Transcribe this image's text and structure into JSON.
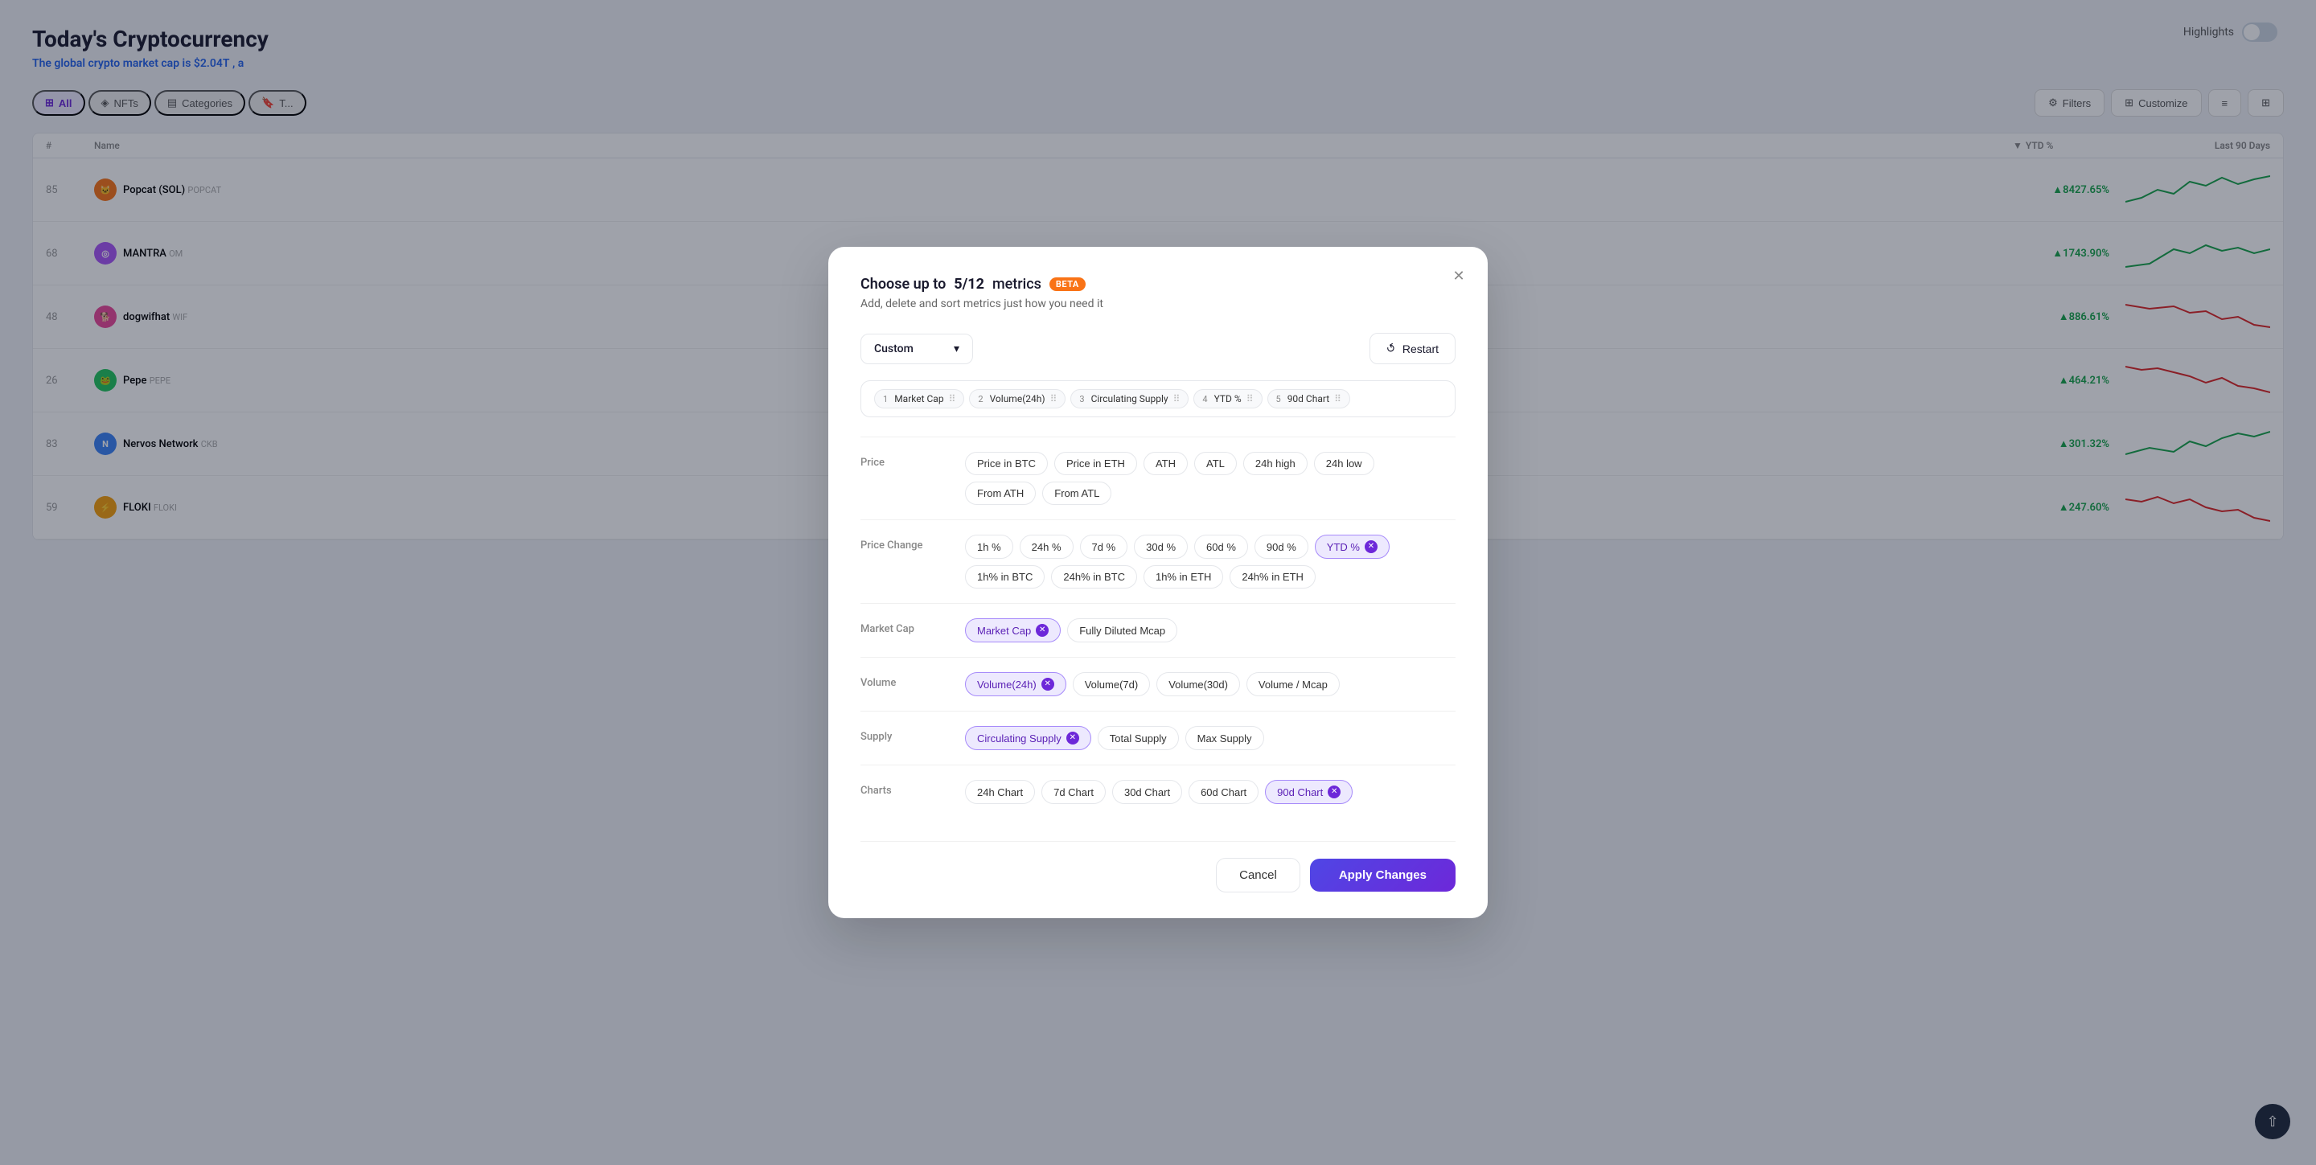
{
  "page": {
    "title": "Today's Cryptocurrency",
    "subtitle_pre": "The global crypto market cap is",
    "subtitle_value": "$2.04T",
    "subtitle_post": ", a",
    "highlights_label": "Highlights"
  },
  "nav": {
    "items": [
      {
        "id": "all",
        "label": "All",
        "active": true
      },
      {
        "id": "nfts",
        "label": "NFTs",
        "active": false
      },
      {
        "id": "categories",
        "label": "Categories",
        "active": false
      },
      {
        "id": "trending",
        "label": "T...",
        "active": false
      }
    ]
  },
  "table": {
    "headers": [
      "#",
      "Name",
      "YTD %",
      "Last 90 Days"
    ],
    "rows": [
      {
        "rank": 85,
        "name": "Popcat (SOL)",
        "ticker": "POPCAT",
        "ytd": "+8427.65%",
        "positive": true,
        "color": "#16a34a"
      },
      {
        "rank": 68,
        "name": "MANTRA",
        "ticker": "OM",
        "ytd": "+1743.90%",
        "positive": true,
        "color": "#16a34a"
      },
      {
        "rank": 48,
        "name": "dogwifhat",
        "ticker": "WIF",
        "ytd": "+886.61%",
        "positive": true,
        "color": "#16a34a"
      },
      {
        "rank": 26,
        "name": "Pepe",
        "ticker": "PEPE",
        "ytd": "+464.21%",
        "positive": true,
        "color": "#16a34a"
      },
      {
        "rank": 83,
        "name": "Nervos Network",
        "ticker": "CKB",
        "ytd": "+301.32%",
        "positive": true,
        "color": "#16a34a"
      },
      {
        "rank": 59,
        "name": "FLOKI",
        "ticker": "FLOKI",
        "ytd": "+247.60%",
        "positive": true,
        "color": "#16a34a"
      }
    ]
  },
  "modal": {
    "title_pre": "Choose up to",
    "count": "5/12",
    "title_post": "metrics",
    "beta_label": "Beta",
    "subtitle": "Add, delete and sort metrics just how you need it",
    "close_label": "×",
    "preset_label": "Custom",
    "preset_chevron": "▾",
    "restart_label": "Restart",
    "active_chips": [
      {
        "num": "1",
        "label": "Market Cap"
      },
      {
        "num": "2",
        "label": "Volume(24h)"
      },
      {
        "num": "3",
        "label": "Circulating Supply"
      },
      {
        "num": "4",
        "label": "YTD %"
      },
      {
        "num": "5",
        "label": "90d Chart"
      }
    ],
    "sections": [
      {
        "id": "price",
        "label": "Price",
        "chips": [
          {
            "id": "price-btc",
            "label": "Price in BTC",
            "selected": false
          },
          {
            "id": "price-eth",
            "label": "Price in ETH",
            "selected": false
          },
          {
            "id": "ath",
            "label": "ATH",
            "selected": false
          },
          {
            "id": "atl",
            "label": "ATL",
            "selected": false
          },
          {
            "id": "24h-high",
            "label": "24h high",
            "selected": false
          },
          {
            "id": "24h-low",
            "label": "24h low",
            "selected": false
          },
          {
            "id": "from-ath",
            "label": "From ATH",
            "selected": false
          },
          {
            "id": "from-atl",
            "label": "From ATL",
            "selected": false
          }
        ]
      },
      {
        "id": "price-change",
        "label": "Price Change",
        "chips": [
          {
            "id": "1h-pct",
            "label": "1h %",
            "selected": false
          },
          {
            "id": "24h-pct",
            "label": "24h %",
            "selected": false
          },
          {
            "id": "7d-pct",
            "label": "7d %",
            "selected": false
          },
          {
            "id": "30d-pct",
            "label": "30d %",
            "selected": false
          },
          {
            "id": "60d-pct",
            "label": "60d %",
            "selected": false
          },
          {
            "id": "90d-pct",
            "label": "90d %",
            "selected": false
          },
          {
            "id": "ytd-pct",
            "label": "YTD %",
            "selected": true
          },
          {
            "id": "1h-btc",
            "label": "1h% in BTC",
            "selected": false
          },
          {
            "id": "24h-btc",
            "label": "24h% in BTC",
            "selected": false
          },
          {
            "id": "1h-eth",
            "label": "1h% in ETH",
            "selected": false
          },
          {
            "id": "24h-eth",
            "label": "24h% in ETH",
            "selected": false
          }
        ]
      },
      {
        "id": "market-cap",
        "label": "Market Cap",
        "chips": [
          {
            "id": "market-cap",
            "label": "Market Cap",
            "selected": true
          },
          {
            "id": "fully-diluted",
            "label": "Fully Diluted Mcap",
            "selected": false
          }
        ]
      },
      {
        "id": "volume",
        "label": "Volume",
        "chips": [
          {
            "id": "vol-24h",
            "label": "Volume(24h)",
            "selected": true
          },
          {
            "id": "vol-7d",
            "label": "Volume(7d)",
            "selected": false
          },
          {
            "id": "vol-30d",
            "label": "Volume(30d)",
            "selected": false
          },
          {
            "id": "vol-mcap",
            "label": "Volume / Mcap",
            "selected": false
          }
        ]
      },
      {
        "id": "supply",
        "label": "Supply",
        "chips": [
          {
            "id": "circ-supply",
            "label": "Circulating Supply",
            "selected": true
          },
          {
            "id": "total-supply",
            "label": "Total Supply",
            "selected": false
          },
          {
            "id": "max-supply",
            "label": "Max Supply",
            "selected": false
          }
        ]
      },
      {
        "id": "charts",
        "label": "Charts",
        "chips": [
          {
            "id": "chart-24h",
            "label": "24h Chart",
            "selected": false
          },
          {
            "id": "chart-7d",
            "label": "7d Chart",
            "selected": false
          },
          {
            "id": "chart-30d",
            "label": "30d Chart",
            "selected": false
          },
          {
            "id": "chart-60d",
            "label": "60d Chart",
            "selected": false
          },
          {
            "id": "chart-90d",
            "label": "90d Chart",
            "selected": true
          }
        ]
      }
    ],
    "cancel_label": "Cancel",
    "apply_label": "Apply Changes"
  },
  "coins": [
    {
      "name": "Popcat (SOL)",
      "ticker": "POPCAT",
      "bg": "#f97316"
    },
    {
      "name": "MANTRA",
      "ticker": "OM",
      "bg": "#a855f7"
    },
    {
      "name": "dogwifhat",
      "ticker": "WIF",
      "bg": "#ec4899"
    },
    {
      "name": "Pepe",
      "ticker": "PEPE",
      "bg": "#22c55e"
    },
    {
      "name": "Nervos Network",
      "ticker": "CKB",
      "bg": "#3b82f6"
    },
    {
      "name": "FLOKI",
      "ticker": "FLOKI",
      "bg": "#f59e0b"
    }
  ]
}
